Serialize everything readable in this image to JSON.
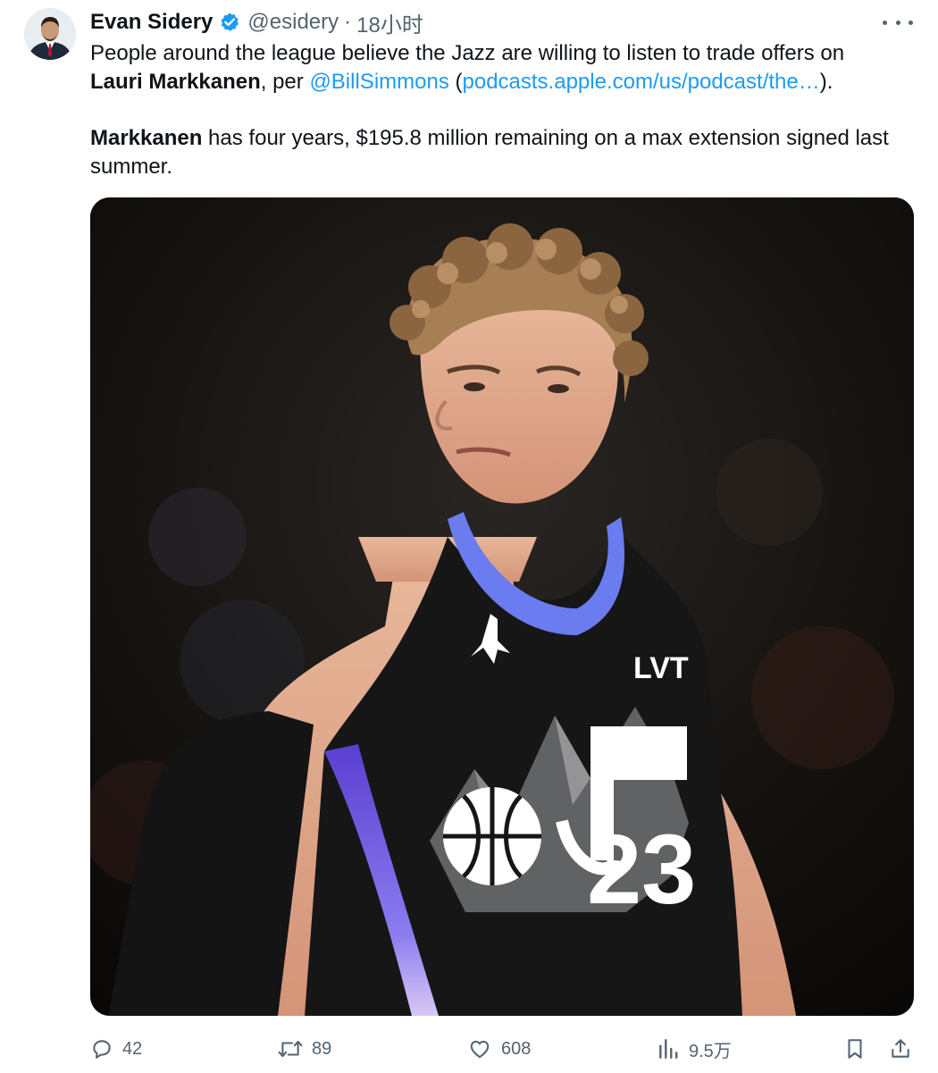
{
  "author": {
    "name": "Evan Sidery",
    "handle": "@esidery",
    "separator": "·",
    "time": "18小时",
    "verified_icon": "verified-badge-icon",
    "avatar_icon": "user-avatar"
  },
  "tweet": {
    "line1_text": "People around the league believe the Jazz are willing to listen to trade offers on",
    "bold_name": "Lauri Markkanen",
    "per_text": ", per ",
    "mention": "@BillSimmons",
    "paren_open": " (",
    "url_text": "podcasts.apple.com/us/podcast/the…",
    "paren_close": ").",
    "para2_bold": "Markkanen",
    "para2_text": " has four years, $195.8 million remaining on a max extension signed last summer."
  },
  "media": {
    "jersey_number": "23",
    "jersey_sponsor": "LVT"
  },
  "actions": {
    "reply_count": "42",
    "retweet_count": "89",
    "like_count": "608",
    "views_count": "9.5万"
  },
  "colors": {
    "text": "#0f1419",
    "secondary": "#536471",
    "link": "#1d9bf0",
    "verified": "#1d9bf0"
  },
  "icons": [
    "more-icon",
    "reply-icon",
    "retweet-icon",
    "like-icon",
    "views-icon",
    "bookmark-icon",
    "share-icon"
  ]
}
